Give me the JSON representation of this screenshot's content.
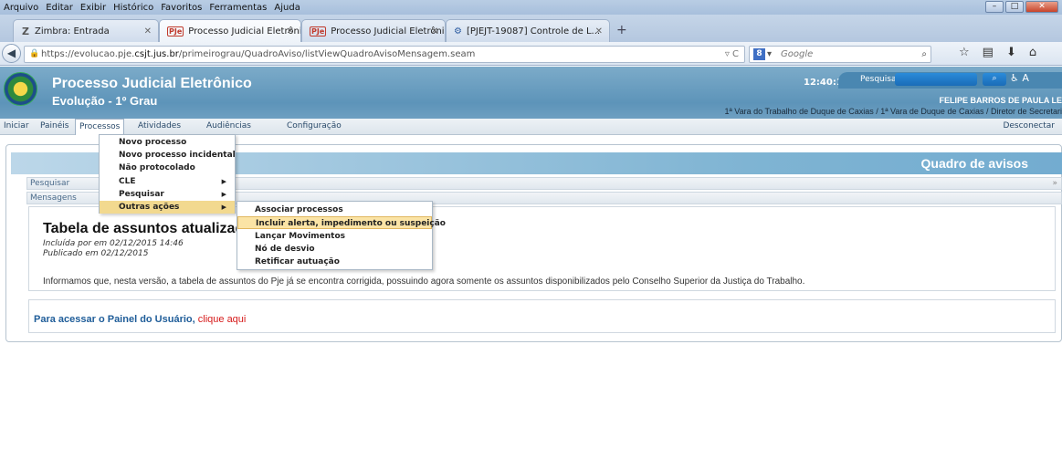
{
  "browser": {
    "menubar": [
      "Arquivo",
      "Editar",
      "Exibir",
      "Histórico",
      "Favoritos",
      "Ferramentas",
      "Ajuda"
    ],
    "tabs": [
      {
        "label": "Zimbra: Entrada",
        "icon": "Z"
      },
      {
        "label": "Processo Judicial Eletrônic...",
        "icon": "PJe"
      },
      {
        "label": "Processo Judicial Eletrônic...",
        "icon": "PJe"
      },
      {
        "label": "[PJEJT-19087] Controle de L...",
        "icon": "jira-icon"
      }
    ],
    "url_prefix": "https://evolucao.pje.",
    "url_domain": "csjt.jus.br",
    "url_path": "/primeirograu/QuadroAviso/listViewQuadroAvisoMensagem.seam",
    "search_placeholder": "Google"
  },
  "header": {
    "title": "Processo Judicial Eletrônico",
    "subtitle": "Evolução - 1º Grau",
    "clock": "12:40:12",
    "search_label": "Pesquisar",
    "user_name": "FELIPE BARROS DE PAULA LE",
    "org_line": "1ª Vara do Trabalho de Duque de Caxias / 1ª Vara de Duque de Caxias / Diretor de Secretari"
  },
  "mainmenu": {
    "items": [
      "Iniciar",
      "Painéis",
      "Processos",
      "Atividades",
      "Audiências",
      "Configuração"
    ],
    "logout": "Desconectar"
  },
  "processos_menu": {
    "items": [
      "Novo processo",
      "Novo processo incidental",
      "Não protocolado",
      "CLE",
      "Pesquisar",
      "Outras ações"
    ]
  },
  "outras_acoes_menu": {
    "items": [
      "Associar processos",
      "Incluir alerta, impedimento ou suspeição",
      "Lançar Movimentos",
      "Nó de desvio",
      "Retificar autuação"
    ]
  },
  "content": {
    "quadro_title": "Quadro de avisos",
    "section_pesquisar": "Pesquisar",
    "section_mensagens": "Mensagens",
    "message": {
      "title": "Tabela de assuntos atualizada",
      "included": "Incluída por em 02/12/2015 14:46",
      "published": "Publicado em 02/12/2015",
      "body": "Informamos que, nesta versão, a tabela de assuntos do Pje já se encontra corrigida, possuindo agora somente os assuntos disponibilizados pelo Conselho Superior da Justiça do Trabalho."
    },
    "painel_text": "Para acessar o Painel do Usuário,",
    "painel_link": "clique aqui"
  },
  "colors": {
    "header_blue": "#5d94b9",
    "highlight": "#f2d98f",
    "link_red": "#d61a1a"
  }
}
